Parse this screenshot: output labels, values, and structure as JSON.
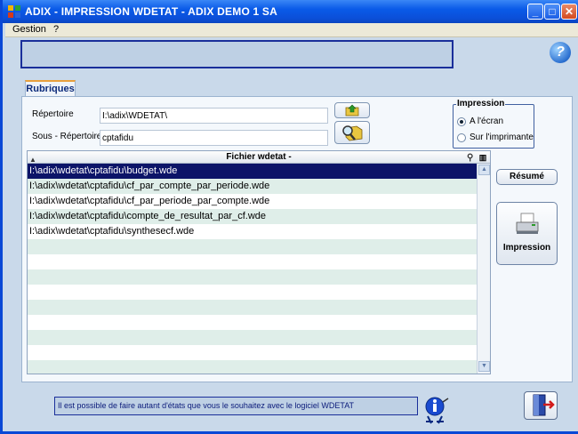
{
  "window": {
    "title": "ADIX - IMPRESSION WDETAT - ADIX DEMO 1 SA",
    "minimize": "_",
    "maximize": "□",
    "close": "✕"
  },
  "menu": {
    "items": [
      "Gestion",
      "?"
    ]
  },
  "tab": {
    "label": "Rubriques"
  },
  "form": {
    "repertoire_label": "Répertoire",
    "repertoire_value": "I:\\adix\\WDETAT\\",
    "sous_repertoire_label": "Sous - Répertoire",
    "sous_repertoire_value": "cptafidu"
  },
  "impression": {
    "legend": "Impression",
    "options": [
      {
        "label": "A l'écran",
        "selected": true
      },
      {
        "label": "Sur l'imprimante",
        "selected": false
      }
    ]
  },
  "table": {
    "header": "Fichier wdetat -",
    "rows": [
      "I:\\adix\\wdetat\\cptafidu\\budget.wde",
      "I:\\adix\\wdetat\\cptafidu\\cf_par_compte_par_periode.wde",
      "I:\\adix\\wdetat\\cptafidu\\cf_par_periode_par_compte.wde",
      "I:\\adix\\wdetat\\cptafidu\\compte_de_resultat_par_cf.wde",
      "I:\\adix\\wdetat\\cptafidu\\synthesecf.wde"
    ],
    "selected_index": 0,
    "total_row_slots": 14
  },
  "buttons": {
    "resume": "Résumé",
    "impression": "Impression"
  },
  "status": {
    "message": "Il est possible de faire autant d'états que vous le souhaitez avec le logiciel WDETAT"
  },
  "icons": {
    "app": "adix-app-icon",
    "help": "help-icon",
    "folder_up": "folder-up-icon",
    "folder_search": "folder-search-icon",
    "printer": "printer-icon",
    "info": "info-mascot-icon",
    "exit": "exit-door-icon"
  }
}
